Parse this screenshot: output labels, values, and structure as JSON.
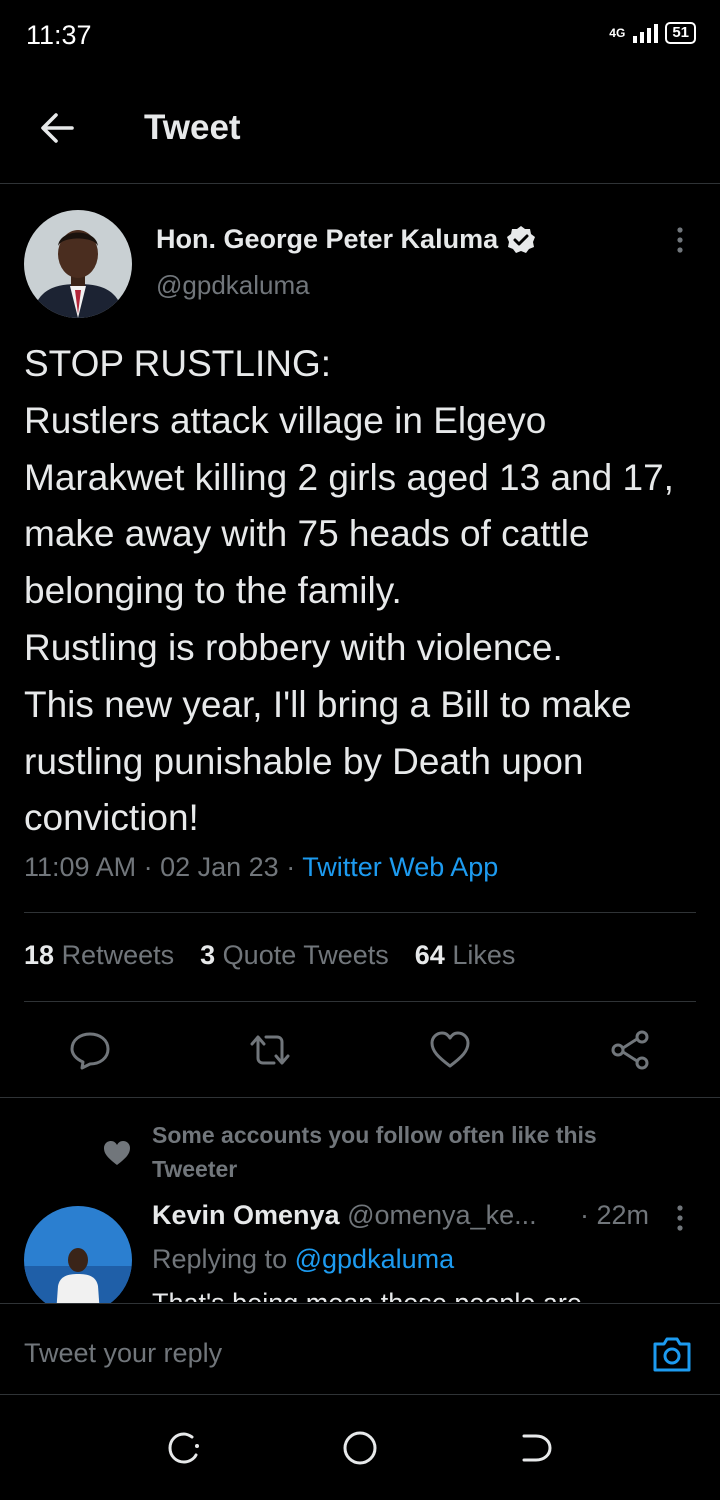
{
  "status_bar": {
    "time": "11:37",
    "network": "4G",
    "battery": "51"
  },
  "header": {
    "title": "Tweet"
  },
  "tweet": {
    "author_name": "Hon. George Peter Kaluma",
    "author_handle": "@gpdkaluma",
    "text": "STOP RUSTLING:\nRustlers attack village in Elgeyo Marakwet killing 2 girls aged 13 and 17, make away with 75 heads of cattle belonging to the family.\nRustling is robbery with violence.\nThis new year, I'll bring a Bill to make rustling punishable by Death upon conviction!",
    "time": "11:09 AM",
    "date": "02 Jan 23",
    "source": "Twitter Web App"
  },
  "stats": {
    "retweets_count": "18",
    "retweets_label": "Retweets",
    "quotes_count": "3",
    "quotes_label": "Quote Tweets",
    "likes_count": "64",
    "likes_label": "Likes"
  },
  "social_context": "Some accounts you follow often like this Tweeter",
  "reply": {
    "name": "Kevin Omenya",
    "handle": "@omenya_ke...",
    "time": "· 22m",
    "replying_prefix": "Replying to",
    "replying_to": "@gpdkaluma",
    "text": "That's being mean these people are"
  },
  "compose": {
    "placeholder": "Tweet your reply"
  },
  "colors": {
    "accent": "#1d9bf0",
    "muted": "#71767b",
    "text": "#e7e9ea",
    "background": "#000000"
  },
  "icons": [
    "back-arrow-icon",
    "verified-badge-icon",
    "more-vertical-icon",
    "reply-icon",
    "retweet-icon",
    "like-icon",
    "share-icon",
    "heart-icon",
    "camera-icon",
    "recents-icon",
    "home-icon",
    "back-nav-icon"
  ]
}
